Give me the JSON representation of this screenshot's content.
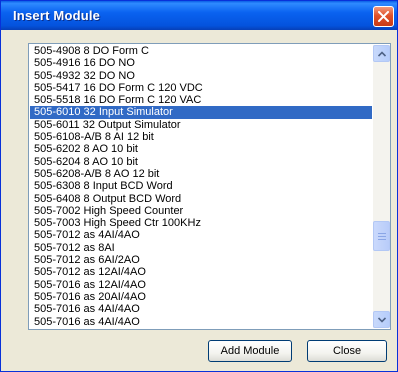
{
  "window": {
    "title": "Insert Module"
  },
  "list": {
    "selected_index": 5,
    "items": [
      "505-4908 8 DO Form C",
      "505-4916 16 DO NO",
      "505-4932 32 DO NO",
      "505-5417 16 DO Form C 120 VDC",
      "505-5518 16 DO Form C 120 VAC",
      "505-6010 32 Input Simulator",
      "505-6011 32 Output Simulator",
      "505-6108-A/B 8 AI 12 bit",
      "505-6202 8 AO 10 bit",
      "505-6204 8 AO 10 bit",
      "505-6208-A/B 8 AO 12 bit",
      "505-6308 8 Input BCD Word",
      "505-6408 8 Output BCD Word",
      "505-7002 High Speed Counter",
      "505-7003 High Speed Ctr 100KHz",
      "505-7012 as 4AI/4AO",
      "505-7012 as 8AI",
      "505-7012 as 6AI/2AO",
      "505-7012 as 12AI/4AO",
      "505-7016 as 12AI/4AO",
      "505-7016 as 20AI/4AO",
      "505-7016 as 4AI/4AO",
      "505-7016 as 4AI/4AO"
    ]
  },
  "buttons": {
    "add_module": "Add Module",
    "close": "Close"
  },
  "icons": {
    "close": "close-x-icon",
    "scroll_up": "chevron-up-icon",
    "scroll_down": "chevron-down-icon"
  }
}
